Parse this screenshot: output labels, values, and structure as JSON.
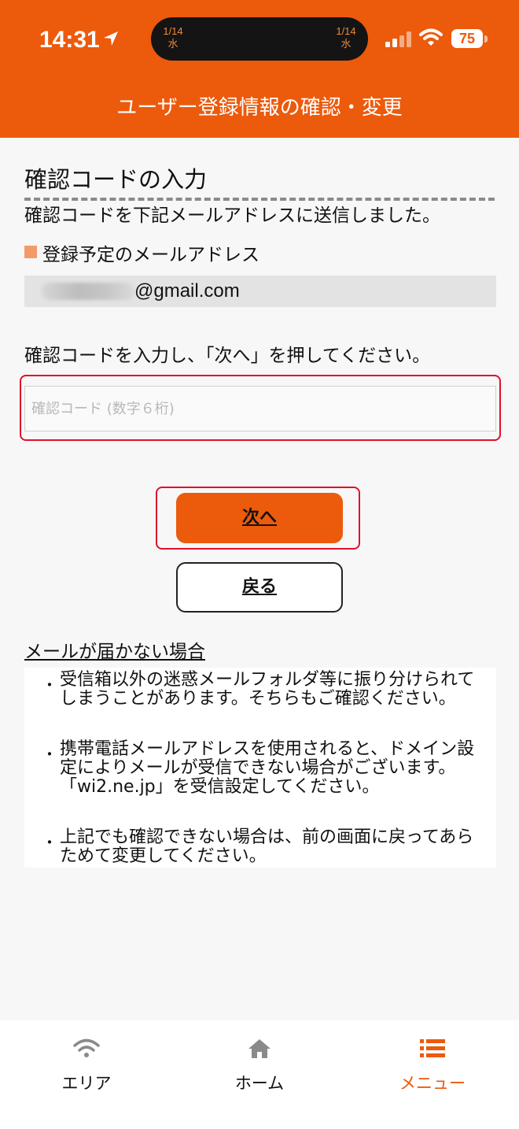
{
  "status_bar": {
    "time": "14:31",
    "island_left_date": "1/14",
    "island_left_day": "水",
    "island_right_date": "1/14",
    "island_right_day": "水",
    "battery": "75"
  },
  "header": {
    "title": "ユーザー登録情報の確認・変更"
  },
  "main": {
    "heading": "確認コードの入力",
    "sent_message": "確認コードを下記メールアドレスに送信しました。",
    "email_label": "登録予定のメールアドレス",
    "email_domain": "@gmail.com",
    "instruction": "確認コードを入力し、「次へ」を押してください。",
    "code_input": {
      "placeholder": "確認コード (数字６桁)",
      "value": ""
    },
    "next_button": "次へ",
    "back_button": "戻る"
  },
  "help": {
    "title": "メールが届かない場合",
    "items": [
      "受信箱以外の迷惑メールフォルダ等に振り分けられてしまうことがあります。そちらもご確認ください。",
      "携帯電話メールアドレスを使用されると、ドメイン設定によりメールが受信できない場合がございます。「wi2.ne.jp」を受信設定してください。",
      "上記でも確認できない場合は、前の画面に戻ってあらためて変更してください。"
    ]
  },
  "tabbar": {
    "tabs": [
      {
        "label": "エリア",
        "icon": "wifi-icon"
      },
      {
        "label": "ホーム",
        "icon": "home-icon"
      },
      {
        "label": "メニュー",
        "icon": "menu-icon",
        "active": true
      }
    ]
  },
  "colors": {
    "brand": "#ec5a0c",
    "highlight": "#e0102a"
  }
}
